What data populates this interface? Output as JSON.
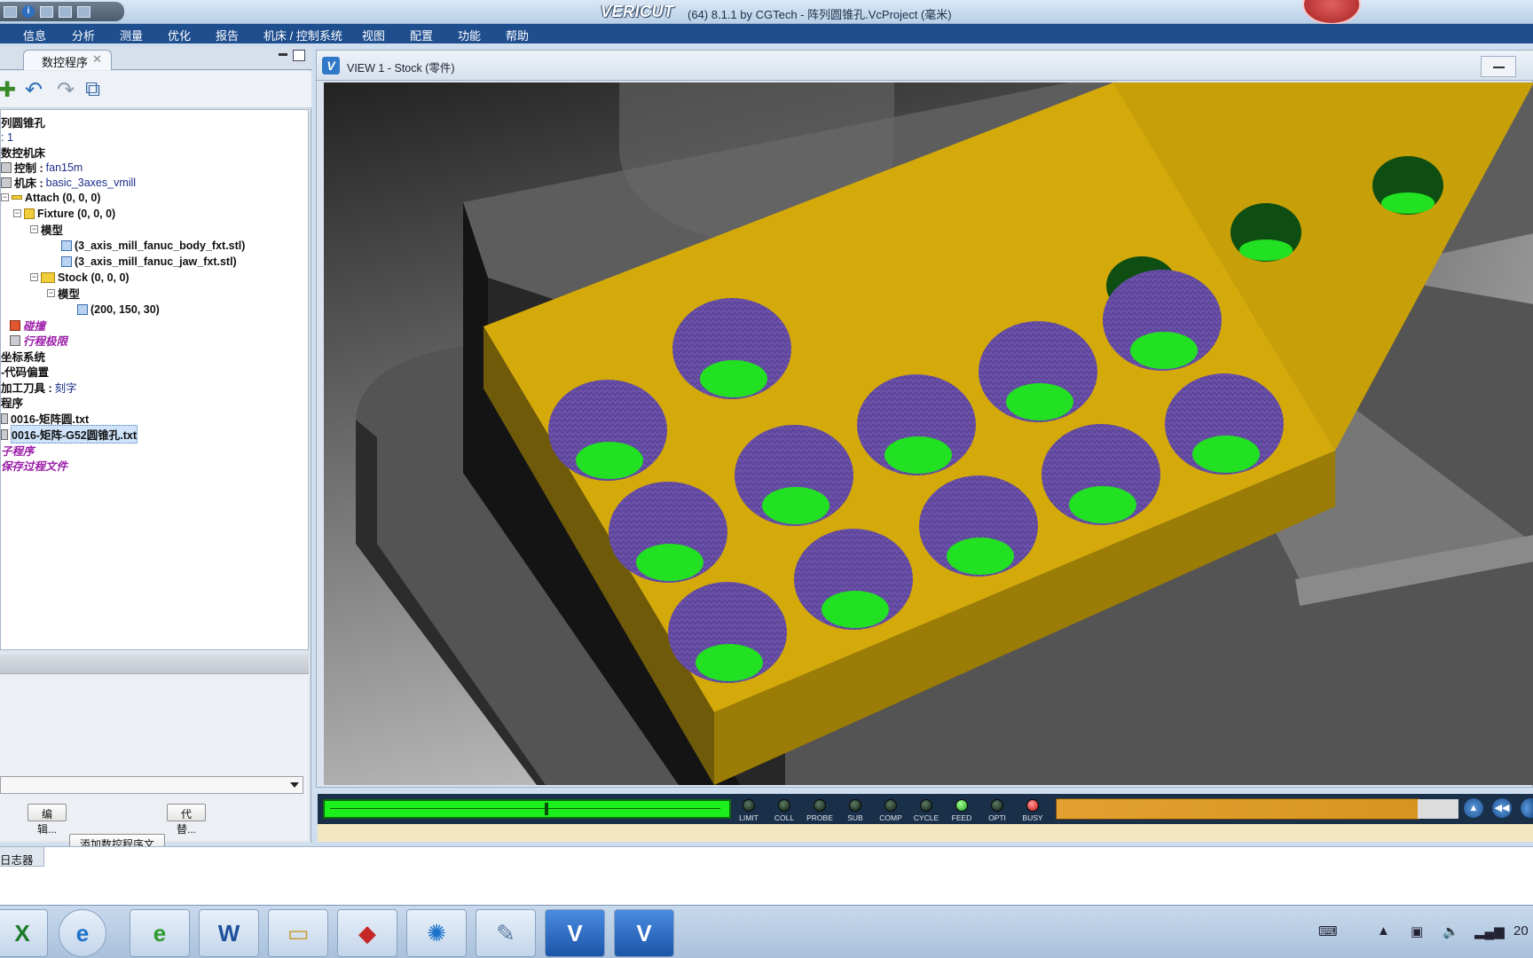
{
  "titlebar": {
    "logo": "VERICUT",
    "title": "(64)  8.1.1 by CGTech - 阵列圆锥孔.VcProject (毫米)"
  },
  "menu": [
    "信息",
    "分析",
    "测量",
    "优化",
    "报告",
    "机床 / 控制系统",
    "视图",
    "配置",
    "功能",
    "帮助"
  ],
  "left_panel": {
    "tab_label": "数控程序",
    "tree": [
      {
        "text": "列圆锥孔",
        "kind": "lbl"
      },
      {
        "label": "",
        "value": ": 1"
      },
      {
        "text": "数控机床",
        "kind": "lbl"
      },
      {
        "label": "控制 : ",
        "value": "fan15m"
      },
      {
        "label": "机床 : ",
        "value": "basic_3axes_vmill"
      },
      {
        "text": "Attach (0, 0, 0)",
        "kind": "lbl"
      },
      {
        "text": "Fixture (0, 0, 0)",
        "kind": "lbl"
      },
      {
        "text": "模型",
        "kind": "lbl"
      },
      {
        "text": "(3_axis_mill_fanuc_body_fxt.stl)",
        "kind": "lbl"
      },
      {
        "text": "(3_axis_mill_fanuc_jaw_fxt.stl)",
        "kind": "lbl"
      },
      {
        "text": "Stock (0, 0, 0)",
        "kind": "lbl"
      },
      {
        "text": "模型",
        "kind": "lbl"
      },
      {
        "text": "(200, 150, 30)",
        "kind": "lbl"
      },
      {
        "text": "碰撞",
        "kind": "pur"
      },
      {
        "text": "行程极限",
        "kind": "pur"
      },
      {
        "text": "坐标系统",
        "kind": "lbl"
      },
      {
        "text": "-代码偏置",
        "kind": "lbl"
      },
      {
        "label": "加工刀具 : ",
        "value": "刻字"
      },
      {
        "text": "程序",
        "kind": "lbl"
      },
      {
        "text": "0016-矩阵圆.txt",
        "kind": "lbl"
      },
      {
        "text": "0016-矩阵-G52圆锥孔.txt",
        "kind": "sel"
      },
      {
        "text": "子程序",
        "kind": "pur"
      },
      {
        "text": "保存过程文件",
        "kind": "pur"
      }
    ],
    "edit_button": "编辑...",
    "replace_button": "代替...",
    "add_button": "添加数控程序文件"
  },
  "viewport": {
    "title": "VIEW 1 - Stock (零件)"
  },
  "status": {
    "leds": [
      "LIMIT",
      "COLL",
      "PROBE",
      "SUB",
      "COMP",
      "CYCLE",
      "FEED",
      "OPTI",
      "BUSY"
    ],
    "progress": 0.55,
    "orange_progress": 0.9
  },
  "logger": {
    "tab_label": "日志器"
  },
  "taskbar": {
    "clock": "20"
  },
  "colors": {
    "stock": "#d4aa0a",
    "hole_wall": "#6a50a8",
    "hole_bottom": "#22e022",
    "menubar": "#1f4e8f"
  }
}
